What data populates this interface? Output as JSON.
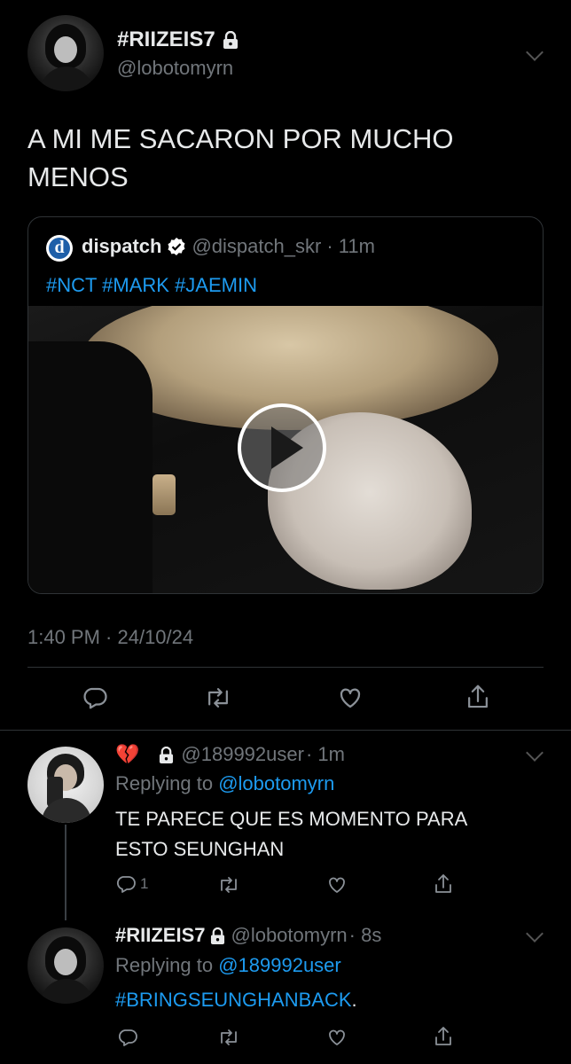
{
  "main_tweet": {
    "display_name": "#RIIZEIS7",
    "handle": "@lobotomyrn",
    "text_line1": "A MI ME SACARON POR MUCHO",
    "text_line2": "MENOS",
    "timestamp": "1:40 PM · 24/10/24"
  },
  "quoted_tweet": {
    "display_name": "dispatch",
    "handle": "@dispatch_skr",
    "time": "· 11m",
    "hashtags": "#NCT #MARK #JAEMIN",
    "avatar_letter": "d"
  },
  "reply1": {
    "emoji": "💔",
    "handle": "@189992user",
    "time": "· 1m",
    "replying_label": "Replying to",
    "replying_to": "@lobotomyrn",
    "text_line1": "TE PARECE QUE ES MOMENTO PARA",
    "text_line2": "ESTO SEUNGHAN",
    "reply_count": "1"
  },
  "reply2": {
    "display_name": "#RIIZEIS7",
    "handle": "@lobotomyrn",
    "time": "· 8s",
    "replying_label": "Replying to",
    "replying_to": "@189992user",
    "hashtag": "#BRINGSEUNGHANBACK",
    "trail": "."
  },
  "icons": [
    "lock-icon",
    "verified-badge-icon",
    "play-icon",
    "reply-icon",
    "retweet-icon",
    "like-icon",
    "share-icon",
    "chevron-down-icon",
    "broken-heart-icon"
  ],
  "colors": {
    "background": "#000000",
    "link": "#1d9bf0",
    "muted": "#71767b",
    "text": "#e7e9ea"
  }
}
